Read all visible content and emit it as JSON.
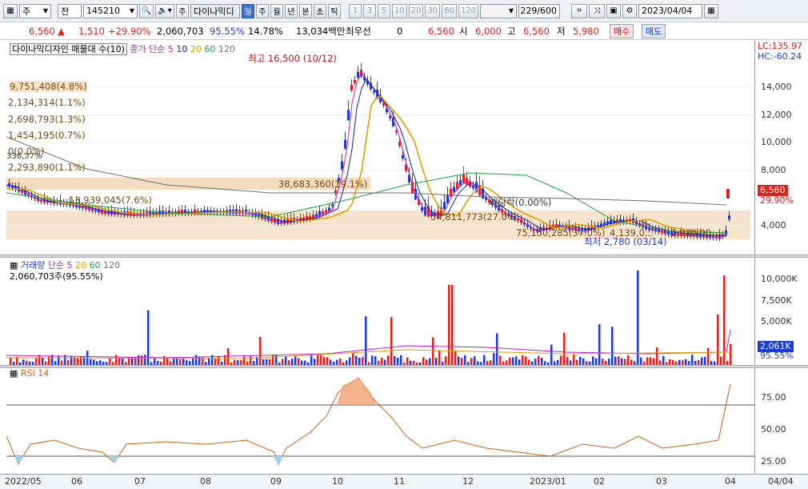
{
  "toolbar": {
    "type_label": "주",
    "mode_label": "전",
    "code": "145210",
    "name": "다이나믹디",
    "periods": [
      "일",
      "주",
      "월",
      "년",
      "분",
      "초",
      "틱"
    ],
    "minutes": [
      "1",
      "3",
      "5",
      "10",
      "20",
      "30",
      "60",
      "120"
    ],
    "count": "229",
    "count_total": "/600",
    "date": "2023/04/04",
    "active_period": "일"
  },
  "quote": {
    "price": "6,560",
    "change": "1,510",
    "change_pct": "+29.90%",
    "volume": "2,060,703",
    "vol_ratio": "95.55%",
    "turnover": "14.78%",
    "amount": "13,034백만",
    "priority_label": "최우선",
    "priority_value": "0",
    "ask": "6,560",
    "open_label": "시",
    "open": "6,000",
    "high_label": "고",
    "high": "6,560",
    "low_label": "저",
    "low": "5,980",
    "buy_label": "매수",
    "sell_label": "매도"
  },
  "price_panel": {
    "legend_title": "다이나믹디자인 매물대 수(10)",
    "ma_label": "종가 단순",
    "ma_periods": [
      "5",
      "10",
      "20",
      "60",
      "120"
    ],
    "lc": "LC:135.97",
    "hc": "HC:-60.24",
    "axis": [
      "14,000",
      "12,000",
      "10,000",
      "8,000",
      "6,000",
      "4,000"
    ],
    "price_tag": "6,560",
    "pct_tag": "29.90%",
    "high_ann": "최고 16,500 (10/12)",
    "low_ann": "최저 2,780 (03/14)",
    "dividend_ann": "배당락(0.00%)",
    "left_pct": "336,37%",
    "volume_profile": [
      "9,751,408(4.8%)",
      "2,134,314(1.1%)",
      "2,698,793(1.3%)",
      "1,454,195(0.7%)",
      "0(0.0%)",
      "2,293,890(1.1%)",
      "38,683,360(19.1%)",
      "13,939,045(7.6%)",
      "54,811,773(27.0%)",
      "75,150,285(37.0%)",
      "4,139,0...",
      "2,930,00..."
    ]
  },
  "volume_panel": {
    "legend_title": "거래량",
    "ma_label": "단순",
    "ma_periods": [
      "5",
      "20",
      "60",
      "120"
    ],
    "current": "2,060,703주(95.55%)",
    "axis": [
      "10,000K",
      "7,500K",
      "5,000K"
    ],
    "vol_tag": "2,061K",
    "pct_tag": "95.55%"
  },
  "rsi_panel": {
    "legend_title": "RSI 14",
    "axis": [
      "75.00",
      "50.00",
      "25.00"
    ]
  },
  "x_axis": [
    "2022/05",
    "06",
    "07",
    "08",
    "09",
    "10",
    "11",
    "12",
    "2023/01",
    "02",
    "03",
    "04",
    "04/04"
  ],
  "colors": {
    "up": "#e0211c",
    "down": "#1b3bd6",
    "ma5": "#c020c0",
    "ma10": "#1020a0",
    "ma20": "#e0a000",
    "ma60": "#20a040",
    "ma120": "#707070"
  }
}
